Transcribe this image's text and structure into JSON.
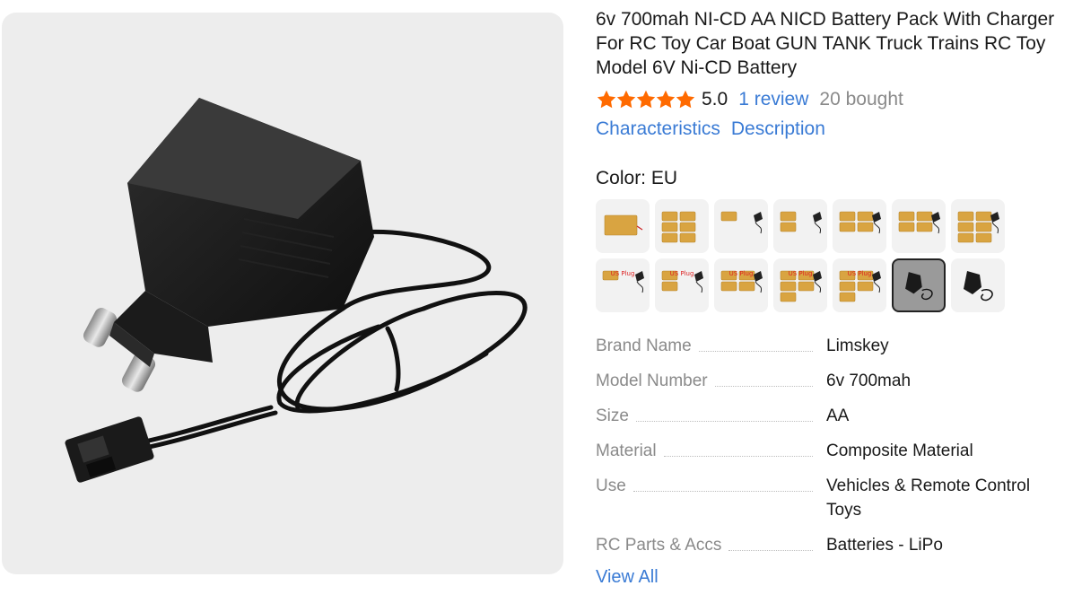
{
  "product": {
    "title": "6v 700mah NI-CD AA NICD Battery Pack With Charger For RC Toy Car Boat GUN TANK Truck Trains RC Toy Model 6V Ni-CD Battery",
    "rating_stars": 5,
    "rating": "5.0",
    "reviews": "1 review",
    "bought": "20 bought"
  },
  "tabs": [
    "Characteristics",
    "Description"
  ],
  "color": {
    "label": "Color: EU",
    "selected_index": 12,
    "swatches": [
      {
        "tag": ""
      },
      {
        "tag": ""
      },
      {
        "tag": ""
      },
      {
        "tag": ""
      },
      {
        "tag": ""
      },
      {
        "tag": ""
      },
      {
        "tag": ""
      },
      {
        "tag": "US Plug"
      },
      {
        "tag": "US Plug"
      },
      {
        "tag": "US Plug"
      },
      {
        "tag": "US Plug"
      },
      {
        "tag": "US Plug"
      },
      {
        "tag": ""
      },
      {
        "tag": ""
      }
    ]
  },
  "specs": [
    {
      "key": "Brand Name",
      "value": "Limskey"
    },
    {
      "key": "Model Number",
      "value": "6v 700mah"
    },
    {
      "key": "Size",
      "value": "AA"
    },
    {
      "key": "Material",
      "value": "Composite Material"
    },
    {
      "key": "Use",
      "value": "Vehicles & Remote Control Toys"
    },
    {
      "key": "RC Parts & Accs",
      "value": "Batteries - LiPo"
    }
  ],
  "view_all": "View All",
  "colors": {
    "star": "#ff6a00",
    "link": "#3a7bd5",
    "muted": "#8a8a8a",
    "image_bg": "#ededed"
  },
  "icons": {
    "rating_star": "star-icon",
    "product_image": "charger-image"
  }
}
